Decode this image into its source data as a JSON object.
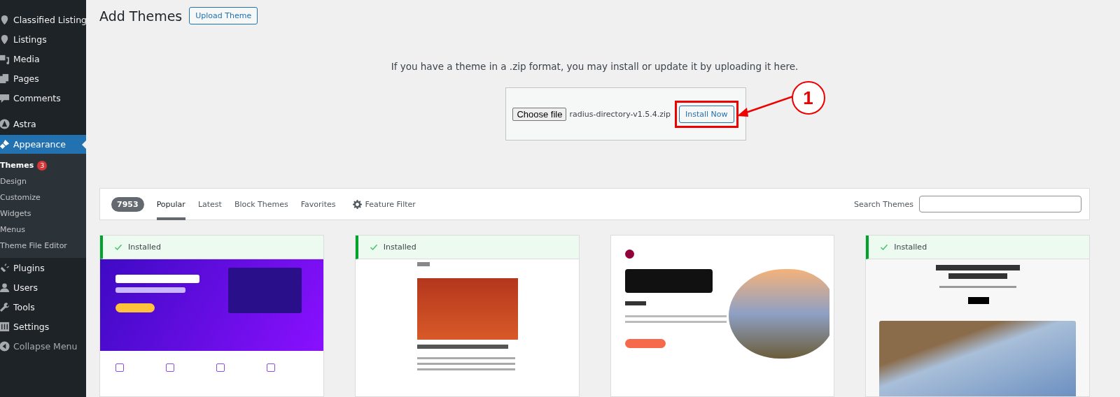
{
  "sidebar": {
    "items": [
      {
        "label": "Classified Listing",
        "selected": false
      },
      {
        "label": "Listings",
        "selected": false
      },
      {
        "label": "Media",
        "selected": false
      },
      {
        "label": "Pages",
        "selected": false
      },
      {
        "label": "Comments",
        "selected": false
      },
      {
        "label": "Astra",
        "selected": false
      },
      {
        "label": "Appearance",
        "selected": true,
        "children": [
          {
            "label": "Themes",
            "selected": true,
            "badge": "3"
          },
          {
            "label": "Design",
            "selected": false
          },
          {
            "label": "Customize",
            "selected": false
          },
          {
            "label": "Widgets",
            "selected": false
          },
          {
            "label": "Menus",
            "selected": false
          },
          {
            "label": "Theme File Editor",
            "selected": false
          }
        ]
      },
      {
        "label": "Plugins",
        "selected": false
      },
      {
        "label": "Users",
        "selected": false
      },
      {
        "label": "Tools",
        "selected": false
      },
      {
        "label": "Settings",
        "selected": false
      },
      {
        "label": "Collapse Menu",
        "selected": false
      }
    ]
  },
  "header": {
    "title": "Add Themes",
    "button": "Upload Theme"
  },
  "upload": {
    "message": "If you have a theme in a .zip format, you may install or update it by uploading it here.",
    "choose_button": "Choose file",
    "file_name": "radius-directory-v1.5.4.zip",
    "install_button": "Install Now"
  },
  "annotation": {
    "number": "1"
  },
  "filter_bar": {
    "count": "7953",
    "tabs": [
      {
        "label": "Popular",
        "selected": true
      },
      {
        "label": "Latest",
        "selected": false
      },
      {
        "label": "Block Themes",
        "selected": false
      },
      {
        "label": "Favorites",
        "selected": false
      }
    ],
    "feature_filter": "Feature Filter",
    "search_label": "Search Themes"
  },
  "themes": [
    {
      "installed": true,
      "status": "Installed",
      "kind": "hero"
    },
    {
      "installed": true,
      "status": "Installed",
      "kind": "blog"
    },
    {
      "installed": false,
      "kind": "hello"
    },
    {
      "installed": true,
      "status": "Installed",
      "kind": "architecture"
    }
  ]
}
